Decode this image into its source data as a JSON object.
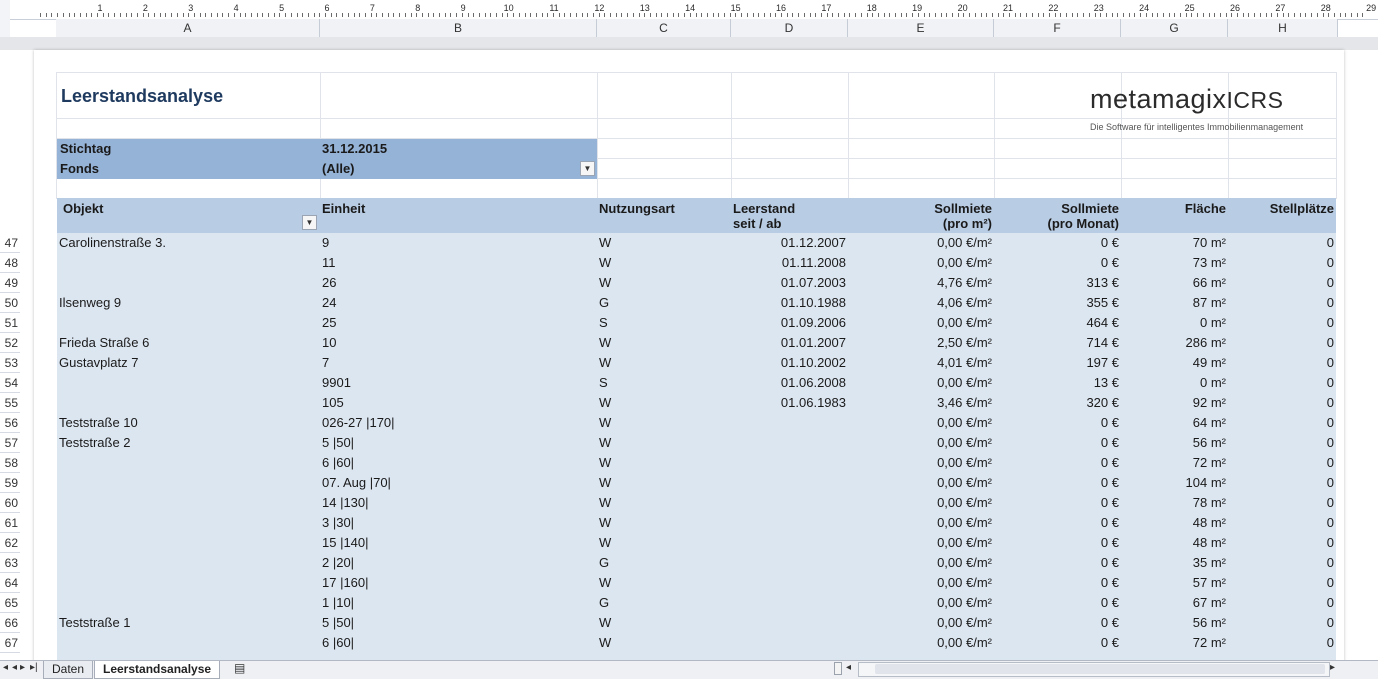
{
  "ruler": {
    "numbers": [
      "1",
      "2",
      "3",
      "4",
      "5",
      "6",
      "7",
      "8",
      "9",
      "10",
      "11",
      "12",
      "13",
      "14",
      "15",
      "16",
      "17",
      "18",
      "19",
      "20",
      "21",
      "22",
      "23",
      "24",
      "25",
      "26",
      "27",
      "28",
      "29"
    ]
  },
  "columns": [
    "A",
    "B",
    "C",
    "D",
    "E",
    "F",
    "G",
    "H"
  ],
  "row_numbers": [
    "47",
    "48",
    "49",
    "50",
    "51",
    "52",
    "53",
    "54",
    "55",
    "56",
    "57",
    "58",
    "59",
    "60",
    "61",
    "62",
    "63",
    "64",
    "65",
    "66",
    "67"
  ],
  "report": {
    "title": "Leerstandsanalyse",
    "logo_main": "metamagix",
    "logo_x": "",
    "logo_suffix": "ICRS",
    "logo_tagline": "Die Software für intelligentes Immobilienmanagement",
    "brand_color": "#c0282c"
  },
  "filters": {
    "stichtag_label": "Stichtag",
    "stichtag_value": "31.12.2015",
    "fonds_label": "Fonds",
    "fonds_value": "(Alle)"
  },
  "table": {
    "headers": {
      "objekt": "Objekt",
      "einheit": "Einheit",
      "nutzungsart": "Nutzungsart",
      "leerstand_1": "Leerstand",
      "leerstand_2": "seit / ab",
      "sollmiete_m2_1": "Sollmiete",
      "sollmiete_m2_2": "(pro m²)",
      "sollmiete_monat_1": "Sollmiete",
      "sollmiete_monat_2": "(pro Monat)",
      "flaeche": "Fläche",
      "stellplaetze": "Stellplätze"
    },
    "rows": [
      {
        "objekt": "Carolinenstraße 3.",
        "einheit": "9",
        "nutzungsart": "W",
        "leerstand": "01.12.2007",
        "sollmiete_m2": "0,00 €/m²",
        "sollmiete_monat": "0 €",
        "flaeche": "70 m²",
        "stellplaetze": "0"
      },
      {
        "objekt": "",
        "einheit": "11",
        "nutzungsart": "W",
        "leerstand": "01.11.2008",
        "sollmiete_m2": "0,00 €/m²",
        "sollmiete_monat": "0 €",
        "flaeche": "73 m²",
        "stellplaetze": "0"
      },
      {
        "objekt": "",
        "einheit": "26",
        "nutzungsart": "W",
        "leerstand": "01.07.2003",
        "sollmiete_m2": "4,76 €/m²",
        "sollmiete_monat": "313 €",
        "flaeche": "66 m²",
        "stellplaetze": "0"
      },
      {
        "objekt": "Ilsenweg 9",
        "einheit": "24",
        "nutzungsart": "G",
        "leerstand": "01.10.1988",
        "sollmiete_m2": "4,06 €/m²",
        "sollmiete_monat": "355 €",
        "flaeche": "87 m²",
        "stellplaetze": "0"
      },
      {
        "objekt": "",
        "einheit": "25",
        "nutzungsart": "S",
        "leerstand": "01.09.2006",
        "sollmiete_m2": "0,00 €/m²",
        "sollmiete_monat": "464 €",
        "flaeche": "0 m²",
        "stellplaetze": "0"
      },
      {
        "objekt": "Frieda Straße 6",
        "einheit": "10",
        "nutzungsart": "W",
        "leerstand": "01.01.2007",
        "sollmiete_m2": "2,50 €/m²",
        "sollmiete_monat": "714 €",
        "flaeche": "286 m²",
        "stellplaetze": "0"
      },
      {
        "objekt": "Gustavplatz 7",
        "einheit": "7",
        "nutzungsart": "W",
        "leerstand": "01.10.2002",
        "sollmiete_m2": "4,01 €/m²",
        "sollmiete_monat": "197 €",
        "flaeche": "49 m²",
        "stellplaetze": "0"
      },
      {
        "objekt": "",
        "einheit": "9901",
        "nutzungsart": "S",
        "leerstand": "01.06.2008",
        "sollmiete_m2": "0,00 €/m²",
        "sollmiete_monat": "13 €",
        "flaeche": "0 m²",
        "stellplaetze": "0"
      },
      {
        "objekt": "",
        "einheit": "105",
        "nutzungsart": "W",
        "leerstand": "01.06.1983",
        "sollmiete_m2": "3,46 €/m²",
        "sollmiete_monat": "320 €",
        "flaeche": "92 m²",
        "stellplaetze": "0"
      },
      {
        "objekt": "Teststraße 10",
        "einheit": "026-27 |170|",
        "nutzungsart": "W",
        "leerstand": "",
        "sollmiete_m2": "0,00 €/m²",
        "sollmiete_monat": "0 €",
        "flaeche": "64 m²",
        "stellplaetze": "0"
      },
      {
        "objekt": "Teststraße 2",
        "einheit": "5 |50|",
        "nutzungsart": "W",
        "leerstand": "",
        "sollmiete_m2": "0,00 €/m²",
        "sollmiete_monat": "0 €",
        "flaeche": "56 m²",
        "stellplaetze": "0"
      },
      {
        "objekt": "",
        "einheit": "6 |60|",
        "nutzungsart": "W",
        "leerstand": "",
        "sollmiete_m2": "0,00 €/m²",
        "sollmiete_monat": "0 €",
        "flaeche": "72 m²",
        "stellplaetze": "0"
      },
      {
        "objekt": "",
        "einheit": "07. Aug |70|",
        "nutzungsart": "W",
        "leerstand": "",
        "sollmiete_m2": "0,00 €/m²",
        "sollmiete_monat": "0 €",
        "flaeche": "104 m²",
        "stellplaetze": "0"
      },
      {
        "objekt": "",
        "einheit": "14 |130|",
        "nutzungsart": "W",
        "leerstand": "",
        "sollmiete_m2": "0,00 €/m²",
        "sollmiete_monat": "0 €",
        "flaeche": "78 m²",
        "stellplaetze": "0"
      },
      {
        "objekt": "",
        "einheit": "3 |30|",
        "nutzungsart": "W",
        "leerstand": "",
        "sollmiete_m2": "0,00 €/m²",
        "sollmiete_monat": "0 €",
        "flaeche": "48 m²",
        "stellplaetze": "0"
      },
      {
        "objekt": "",
        "einheit": "15 |140|",
        "nutzungsart": "W",
        "leerstand": "",
        "sollmiete_m2": "0,00 €/m²",
        "sollmiete_monat": "0 €",
        "flaeche": "48 m²",
        "stellplaetze": "0"
      },
      {
        "objekt": "",
        "einheit": "2 |20|",
        "nutzungsart": "G",
        "leerstand": "",
        "sollmiete_m2": "0,00 €/m²",
        "sollmiete_monat": "0 €",
        "flaeche": "35 m²",
        "stellplaetze": "0"
      },
      {
        "objekt": "",
        "einheit": "17 |160|",
        "nutzungsart": "W",
        "leerstand": "",
        "sollmiete_m2": "0,00 €/m²",
        "sollmiete_monat": "0 €",
        "flaeche": "57 m²",
        "stellplaetze": "0"
      },
      {
        "objekt": "",
        "einheit": "1 |10|",
        "nutzungsart": "G",
        "leerstand": "",
        "sollmiete_m2": "0,00 €/m²",
        "sollmiete_monat": "0 €",
        "flaeche": "67 m²",
        "stellplaetze": "0"
      },
      {
        "objekt": "Teststraße 1",
        "einheit": "5 |50|",
        "nutzungsart": "W",
        "leerstand": "",
        "sollmiete_m2": "0,00 €/m²",
        "sollmiete_monat": "0 €",
        "flaeche": "56 m²",
        "stellplaetze": "0"
      },
      {
        "objekt": "",
        "einheit": "6 |60|",
        "nutzungsart": "W",
        "leerstand": "",
        "sollmiete_m2": "0,00 €/m²",
        "sollmiete_monat": "0 €",
        "flaeche": "72 m²",
        "stellplaetze": "0"
      }
    ]
  },
  "sheet_tabs": [
    {
      "label": "Daten",
      "active": false
    },
    {
      "label": "Leerstandsanalyse",
      "active": true
    }
  ],
  "icons": {
    "nav_first": "first-sheet-icon",
    "nav_prev": "prev-sheet-icon",
    "nav_next": "next-sheet-icon",
    "nav_last": "last-sheet-icon",
    "new_sheet": "insert-sheet-icon",
    "dropdown": "dropdown-arrow-icon"
  }
}
